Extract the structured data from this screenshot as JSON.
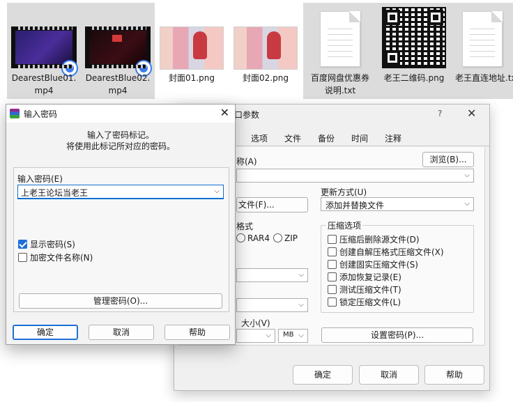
{
  "desktop": {
    "files": [
      {
        "name": "DearestBlue01.\nmp4",
        "kind": "video",
        "selected": true
      },
      {
        "name": "DearestBlue02.\nmp4",
        "kind": "video",
        "selected": true
      },
      {
        "name": "封面01.png",
        "kind": "image",
        "selected": false
      },
      {
        "name": "封面02.png",
        "kind": "image",
        "selected": false
      },
      {
        "name": "百度网盘优惠券\n说明.txt",
        "kind": "text",
        "selected": true
      },
      {
        "name": "老王二维码.png",
        "kind": "qr",
        "selected": true
      },
      {
        "name": "老王直连地址.txt",
        "kind": "text",
        "selected": true
      }
    ]
  },
  "archive_window": {
    "title_fragment": "口参数",
    "help": "?",
    "tabs": [
      "选项",
      "文件",
      "备份",
      "时间",
      "注释"
    ],
    "name_label": "称(A)",
    "browse_button": "浏览(B)...",
    "profiles_button": "文件(F)...",
    "update_label": "更新方式(U)",
    "update_value": "添加并替换文件",
    "format_label": "格式",
    "format_options": [
      "RAR4",
      "ZIP"
    ],
    "options_group": "压缩选项",
    "options": [
      {
        "label": "压缩后删除源文件(D)",
        "checked": false
      },
      {
        "label": "创建自解压格式压缩文件(X)",
        "checked": false
      },
      {
        "label": "创建固实压缩文件(S)",
        "checked": false
      },
      {
        "label": "添加恢复记录(E)",
        "checked": false
      },
      {
        "label": "测试压缩文件(T)",
        "checked": false
      },
      {
        "label": "锁定压缩文件(L)",
        "checked": false
      }
    ],
    "volume_label": "大小(V)",
    "volume_unit": "MB",
    "set_password_button": "设置密码(P)...",
    "ok": "确定",
    "cancel": "取消",
    "help_button": "帮助"
  },
  "password_dialog": {
    "title": "输入密码",
    "message_line1": "输入了密码标记。",
    "message_line2": "将使用此标记所对应的密码。",
    "input_label": "输入密码(E)",
    "input_value": "上老王论坛当老王",
    "show_password": {
      "label": "显示密码(S)",
      "checked": true
    },
    "encrypt_names": {
      "label": "加密文件名称(N)",
      "checked": false
    },
    "manage_button": "管理密码(O)...",
    "ok": "确定",
    "cancel": "取消",
    "help": "帮助"
  },
  "colors": {
    "accent": "#1e6fd9",
    "selection": "#dcdcdc"
  }
}
